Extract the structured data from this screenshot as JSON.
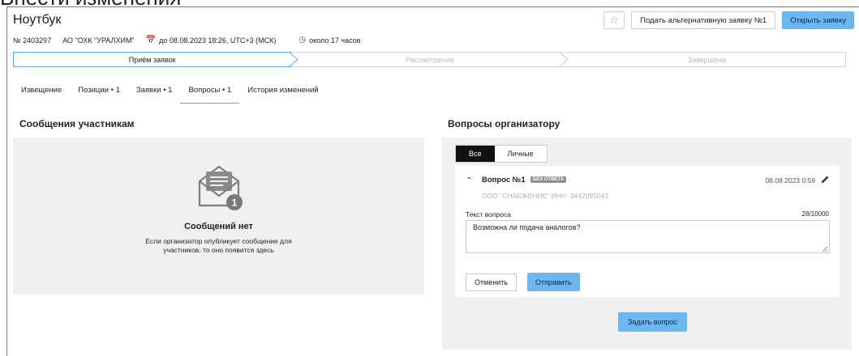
{
  "page": {
    "cut_text": "Внести изменения"
  },
  "header": {
    "title": "Ноутбук",
    "star_icon": "star-icon",
    "alt_bid_button": "Подать альтернативную заявку №1",
    "open_bid_button": "Открыть заявку"
  },
  "meta": {
    "number": "№ 2403297",
    "organization": "АО \"ОХК \"УРАЛХИМ\"",
    "deadline": "до 08.08.2023 18:26, UTC+3 (МСК)",
    "remaining": "около 17 часов",
    "deadline_icon": "calendar-icon",
    "remaining_icon": "clock-icon"
  },
  "steps": [
    {
      "label": "Приём заявок",
      "active": true
    },
    {
      "label": "Рассмотрение",
      "active": false
    },
    {
      "label": "Завершена",
      "active": false
    }
  ],
  "tabs": [
    {
      "label": "Извещение"
    },
    {
      "label": "Позиции • 1"
    },
    {
      "label": "Заявки • 1"
    },
    {
      "label": "Вопросы • 1",
      "active": true
    },
    {
      "label": "История изменений"
    }
  ],
  "messages": {
    "heading": "Сообщения участникам",
    "empty_title": "Сообщений нет",
    "empty_desc_line1": "Если организатор опубликует сообщение для",
    "empty_desc_line2": "участников, то оно появится здесь",
    "badge_count": "1",
    "icon": "open-envelope-icon"
  },
  "questions": {
    "heading": "Вопросы организатору",
    "filter_all": "Все",
    "filter_personal": "Личные",
    "card": {
      "title": "Вопрос №1",
      "badge": "БЕЗ ОТВЕТА",
      "date": "08.08.2023 0:59",
      "organization": "ООО \"СНАБЖЕНИЕ\" ИНН: 3442095043",
      "text_label": "Текст вопроса",
      "char_count": "28/10000",
      "text_value": "Возможна ли подача аналогов?",
      "cancel_label": "Отменить",
      "send_label": "Отправить"
    },
    "ask_label": "Задать вопрос"
  },
  "colors": {
    "accent": "#6cb7f0",
    "active_border": "#5aa9e6",
    "panel_bg": "#f0f0f0",
    "badge_bg": "#8f8f8f"
  }
}
